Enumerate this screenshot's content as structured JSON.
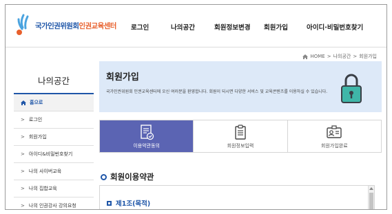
{
  "header": {
    "logo": {
      "main": "국가인권위원회",
      "sub": "인권교육센터"
    },
    "nav": [
      "로그인",
      "나의공간",
      "회원정보변경",
      "회원가입",
      "아이디·비밀번호찾기"
    ]
  },
  "breadcrumb": {
    "items": [
      "HOME",
      ">",
      "나의공간",
      ">",
      "회원가입"
    ]
  },
  "sidebar": {
    "title": "나의공간",
    "items": [
      {
        "label": "홈으로",
        "icon": "home-icon"
      },
      {
        "label": "로그인",
        "icon": "chevron-right-icon"
      },
      {
        "label": "회원가입",
        "icon": "chevron-right-icon"
      },
      {
        "label": "아이디&비밀번호찾기",
        "icon": "chevron-right-icon"
      },
      {
        "label": "나의 사이버교육",
        "icon": "chevron-right-icon"
      },
      {
        "label": "나의 집합교육",
        "icon": "chevron-right-icon"
      },
      {
        "label": "나의 인권강사 강의요청",
        "icon": "chevron-right-icon"
      }
    ]
  },
  "banner": {
    "title": "회원가입",
    "desc": "국가인권위원회 인권교육센터에 오신 여러분을 환영합니다. 회원이 되시면 다양한 서비스 및 교육콘텐츠를 이용하실 수 있습니다.",
    "icon": "lock-icon"
  },
  "steps": [
    {
      "label": "이용약관동의",
      "icon": "document-check-icon",
      "active": true
    },
    {
      "label": "회원정보입력",
      "icon": "clipboard-icon",
      "active": false
    },
    {
      "label": "회원가입완료",
      "icon": "id-card-icon",
      "active": false
    }
  ],
  "section": {
    "title": "회원이용약관"
  },
  "terms": {
    "article_title": "제1조(목적)"
  },
  "colors": {
    "primary": "#1f56a8",
    "accent": "#e8602c",
    "step_active": "#5b64b3",
    "banner_bg": "#dde9f8"
  }
}
